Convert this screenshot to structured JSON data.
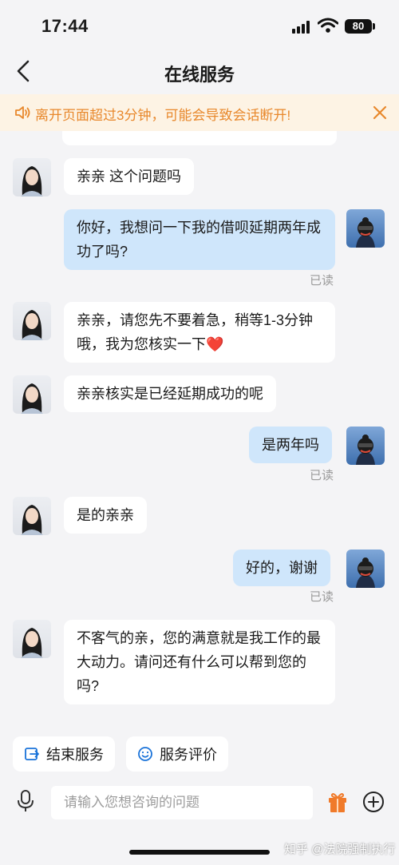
{
  "status_bar": {
    "time": "17:44",
    "battery": "80"
  },
  "nav": {
    "title": "在线服务"
  },
  "notice": {
    "text": "离开页面超过3分钟，可能会导致会话断开!"
  },
  "chat": {
    "messages": [
      {
        "sender": "agent",
        "text": "亲亲 这个问题吗"
      },
      {
        "sender": "user",
        "text": "你好，我想问一下我的借呗延期两年成功了吗?",
        "status": "已读"
      },
      {
        "sender": "agent",
        "text": "亲亲，请您先不要着急，稍等1-3分钟哦，我为您核实一下❤️"
      },
      {
        "sender": "agent",
        "text": "亲亲核实是已经延期成功的呢"
      },
      {
        "sender": "user",
        "text": "是两年吗",
        "status": "已读"
      },
      {
        "sender": "agent",
        "text": "是的亲亲"
      },
      {
        "sender": "user",
        "text": "好的，谢谢",
        "status": "已读"
      },
      {
        "sender": "agent",
        "text": "不客气的亲，您的满意就是我工作的最大动力。请问还有什么可以帮到您的吗?"
      }
    ]
  },
  "quick_actions": {
    "end_service": "结束服务",
    "rate_service": "服务评价"
  },
  "input": {
    "placeholder": "请输入您想咨询的问题"
  },
  "watermark": "知乎 @法院强制执行",
  "colors": {
    "notice_text": "#e8882c",
    "user_bubble": "#cfe6fb",
    "accent_blue": "#1a73d9",
    "gift": "#f07a2a"
  }
}
